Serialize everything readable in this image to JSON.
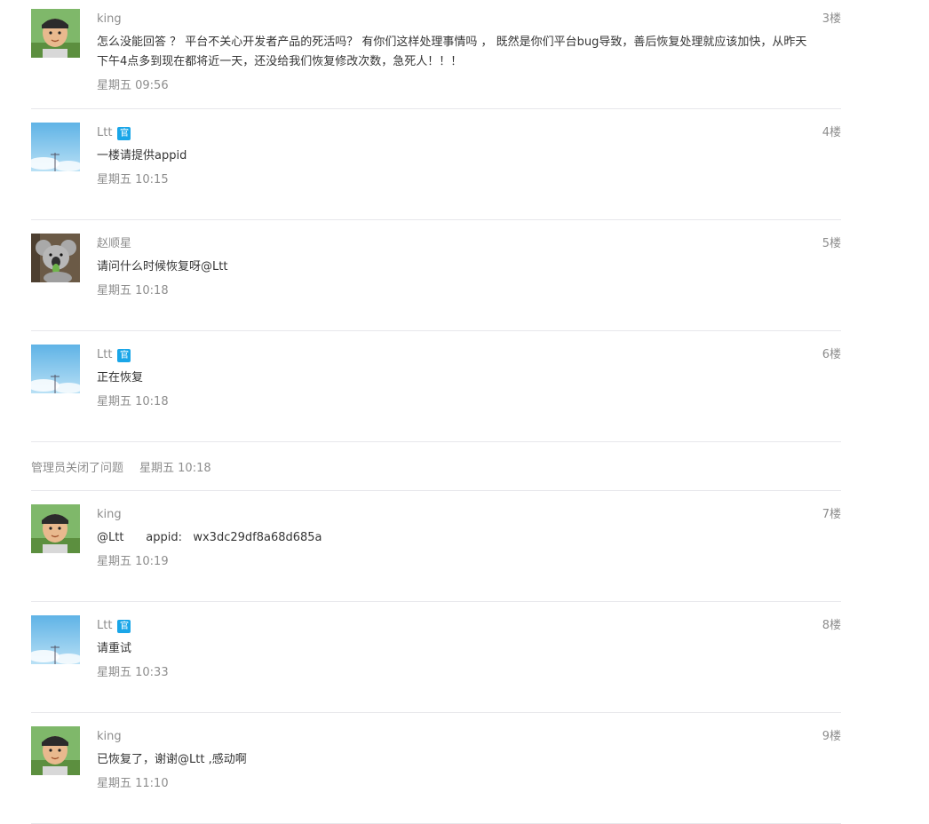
{
  "replies_before": [
    {
      "author": "king",
      "official": false,
      "avatar": "boy-avatar",
      "floor": "3楼",
      "text": "怎么没能回答 ？ 平台不关心开发者产品的死活吗？ 有你们这样处理事情吗 ， 既然是你们平台bug导致，善后恢复处理就应该加快，从昨天下午4点多到现在都将近一天，还没给我们恢复修改次数，急死人！！！",
      "time": "星期五 09:56"
    },
    {
      "author": "Ltt",
      "official": true,
      "avatar": "sky-avatar",
      "floor": "4楼",
      "text": "一楼请提供appid",
      "time": "星期五 10:15"
    },
    {
      "author": "赵顺星",
      "official": false,
      "avatar": "koala-avatar",
      "floor": "5楼",
      "text": "请问什么时候恢复呀@Ltt",
      "time": "星期五 10:18"
    },
    {
      "author": "Ltt",
      "official": true,
      "avatar": "sky-avatar",
      "floor": "6楼",
      "text": "正在恢复",
      "time": "星期五 10:18"
    }
  ],
  "notice": {
    "text": "管理员关闭了问题",
    "time": "星期五 10:18"
  },
  "replies_after": [
    {
      "author": "king",
      "official": false,
      "avatar": "boy-avatar",
      "floor": "7楼",
      "text": "@Ltt      appid:   wx3dc29df8a68d685a",
      "time": "星期五 10:19"
    },
    {
      "author": "Ltt",
      "official": true,
      "avatar": "sky-avatar",
      "floor": "8楼",
      "text": "请重试",
      "time": "星期五 10:33"
    },
    {
      "author": "king",
      "official": false,
      "avatar": "boy-avatar",
      "floor": "9楼",
      "text": "已恢复了，谢谢@Ltt ,感动啊",
      "time": "星期五 11:10"
    }
  ],
  "official_badge": "官",
  "colors": {
    "badge": "#1aa6e8",
    "meta_text": "#8d8d8d",
    "body_text": "#353535",
    "divider": "#e7e7eb"
  }
}
